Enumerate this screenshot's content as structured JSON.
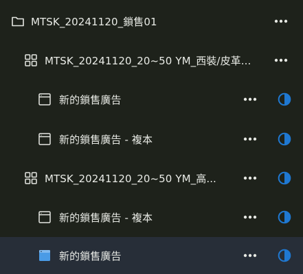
{
  "tree": {
    "campaign": {
      "label": "MTSK_20241120_鎖售01",
      "icon": "folder-icon"
    },
    "adset1": {
      "label": "MTSK_20241120_20~50 YM_西裝/皮革...",
      "icon": "grid-icon"
    },
    "ad1": {
      "label": "新的鎖售廣告",
      "icon": "ad-window-icon"
    },
    "ad2": {
      "label": "新的鎖售廣告 - 複本",
      "icon": "ad-window-icon"
    },
    "adset2": {
      "label": "MTSK_20241120_20~50 YM_高...",
      "icon": "grid-icon"
    },
    "ad3": {
      "label": "新的鎖售廣告 - 複本",
      "icon": "ad-window-icon"
    },
    "ad4": {
      "label": "新的鎖售廣告",
      "icon": "ad-window-icon",
      "selected": true
    }
  },
  "colors": {
    "background": "#1e221b",
    "selected_row": "#272e38",
    "text": "#e9ebe6",
    "accent_blue": "#1f78d1",
    "selected_icon": "#4a9be6"
  }
}
